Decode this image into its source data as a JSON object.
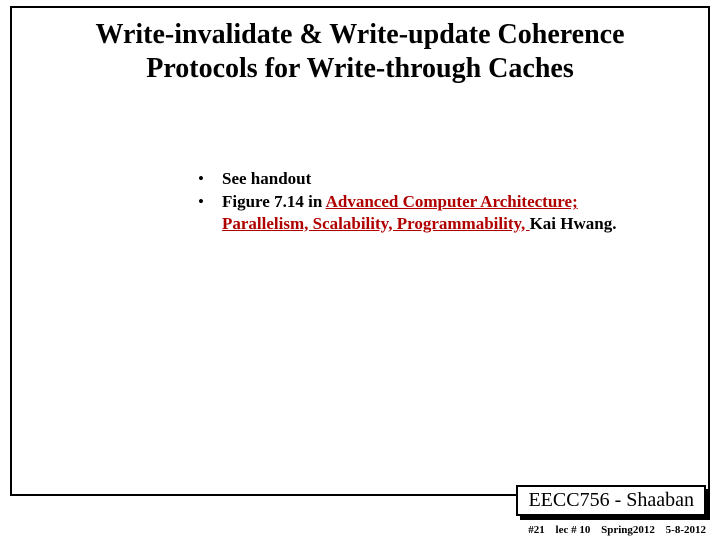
{
  "title_line1": "Write-invalidate & Write-update Coherence",
  "title_line2": "Protocols for Write-through Caches",
  "bullets": {
    "b1": "See handout",
    "b2_prefix": "Figure 7.14  in  ",
    "b2_book": "Advanced Computer Architecture; Parallelism, Scalability, Programmability, ",
    "b2_author": "Kai Hwang."
  },
  "course": "EECC756 - Shaaban",
  "footer": {
    "slide_no": "#21",
    "lecture": "lec # 10",
    "term": "Spring2012",
    "date": "5-8-2012"
  }
}
